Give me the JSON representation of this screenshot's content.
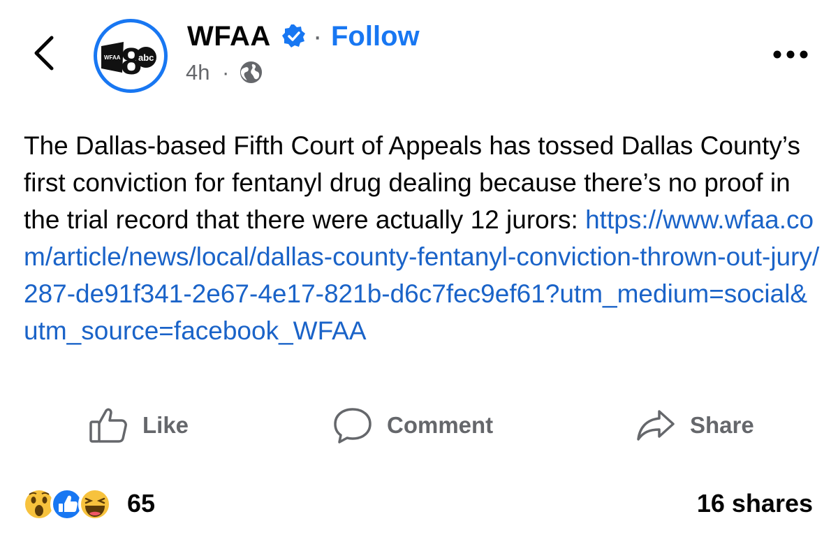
{
  "header": {
    "page_name": "WFAA",
    "separator": "·",
    "follow_label": "Follow",
    "time": "4h",
    "time_separator": "·",
    "avatar_text": "WFAA",
    "avatar_logo_text": "abc",
    "avatar_number": "8"
  },
  "post": {
    "text": "The Dallas-based Fifth Court of Appeals has tossed Dallas County’s first conviction for fentanyl drug dealing because there’s no proof in the trial record that there were actually 12 jurors: ",
    "link": "https://www.wfaa.com/article/news/local/dallas-county-fentanyl-conviction-thrown-out-jury/287-de91f341-2e67-4e17-821b-d6c7fec9ef61?utm_medium=social&utm_source=facebook_WFAA"
  },
  "actions": {
    "like": "Like",
    "comment": "Comment",
    "share": "Share"
  },
  "footer": {
    "reaction_count": "65",
    "shares": "16 shares"
  },
  "colors": {
    "brand_blue": "#1877f2",
    "link_blue": "#1a63c8",
    "secondary_text": "#65676b",
    "wow_yellow": "#f7c23d",
    "like_blue": "#1877f2"
  },
  "icons": [
    "back-arrow-icon",
    "verified-badge-icon",
    "globe-icon",
    "more-options-icon",
    "like-icon",
    "comment-icon",
    "share-icon",
    "wow-reaction-icon",
    "like-reaction-icon",
    "haha-reaction-icon"
  ]
}
